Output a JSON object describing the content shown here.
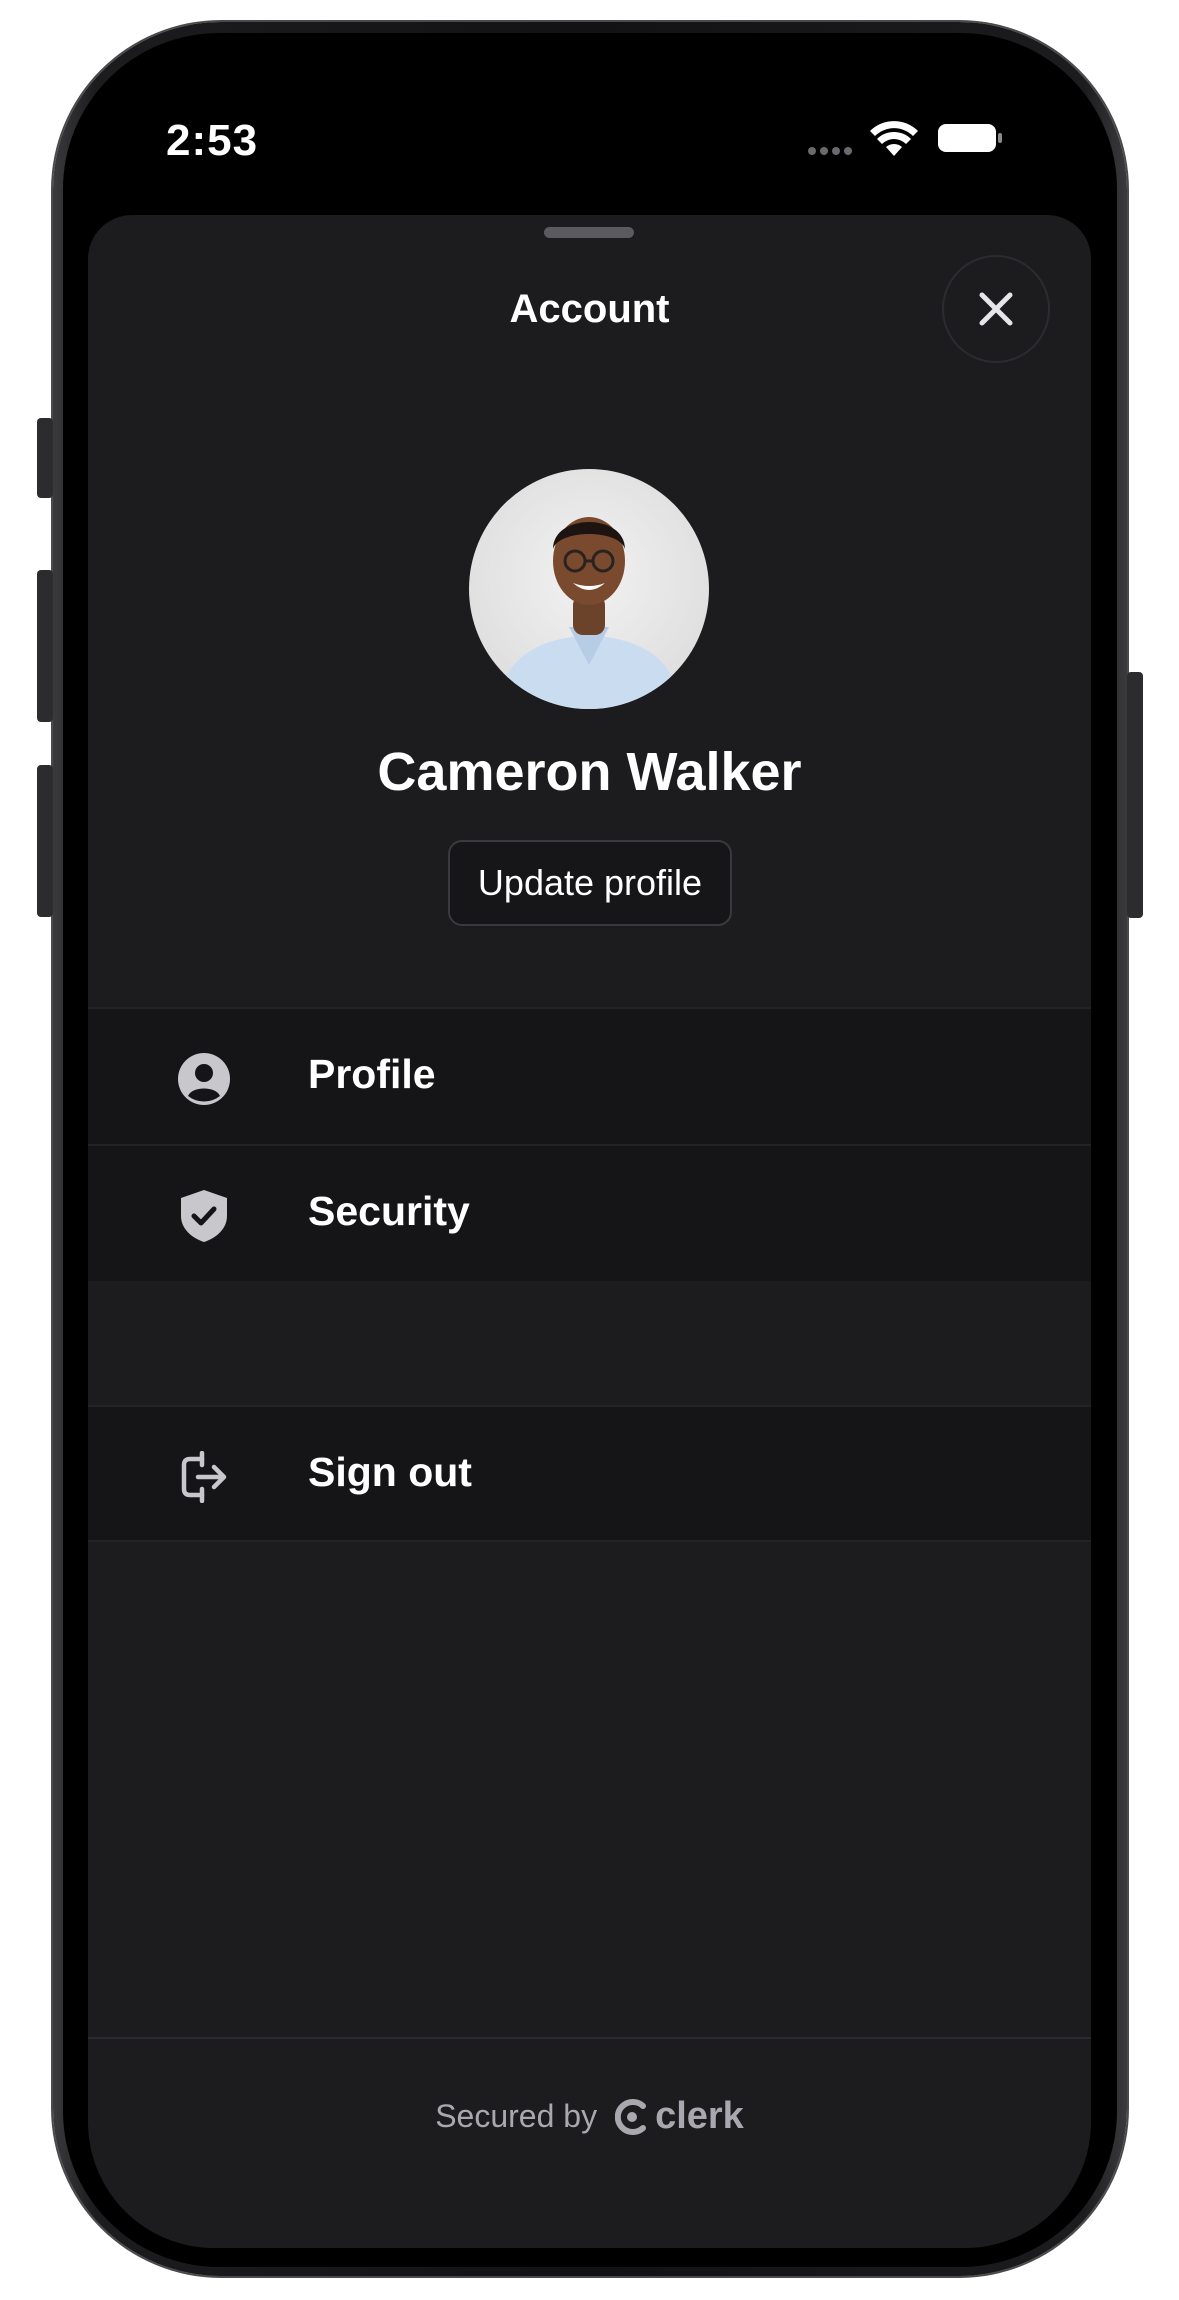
{
  "status_bar": {
    "time": "2:53"
  },
  "sheet": {
    "title": "Account"
  },
  "user": {
    "name": "Cameron Walker",
    "update_button_label": "Update profile"
  },
  "menu": {
    "items": [
      {
        "label": "Profile",
        "icon": "person-circle-icon"
      },
      {
        "label": "Security",
        "icon": "shield-check-icon"
      }
    ],
    "sign_out": {
      "label": "Sign out",
      "icon": "sign-out-icon"
    }
  },
  "footer": {
    "secured_by": "Secured by",
    "brand": "clerk"
  },
  "colors": {
    "sheet_background": "#1c1c1f",
    "row_background": "#151517",
    "text_primary": "#ffffff",
    "text_secondary": "#a8a8ae"
  }
}
